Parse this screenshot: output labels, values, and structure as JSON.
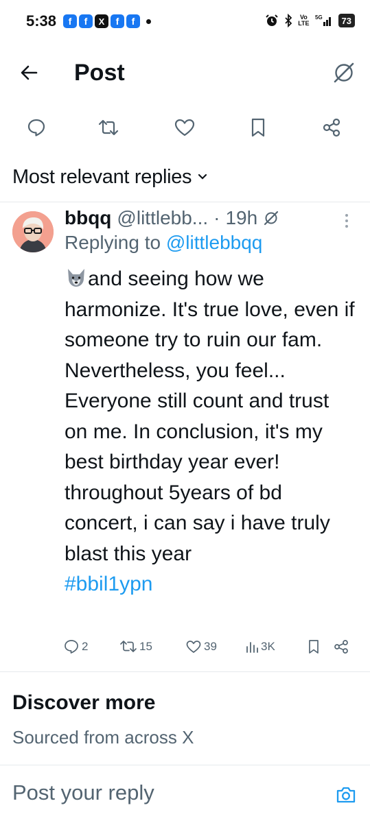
{
  "status_bar": {
    "time": "5:38",
    "app_icons": [
      "f",
      "f",
      "X",
      "f",
      "f"
    ],
    "volte": [
      "Vo",
      "LTE"
    ],
    "network": "5G",
    "battery": "73"
  },
  "header": {
    "title": "Post"
  },
  "sort": {
    "label": "Most relevant replies"
  },
  "reply": {
    "name": "bbqq",
    "handle": "@littlebb...",
    "separator": "·",
    "time": "19h",
    "replying_prefix": "Replying to",
    "replying_handle": "@littlebbqq",
    "text": "and seeing how we harmonize. It's true love, even if someone try to ruin our fam. Nevertheless, you feel... Everyone still count and trust on me. In conclusion, it's my best birthday year ever! throughout 5years of bd concert, i can say i have truly blast this year",
    "hashtag": "#bbil1ypn",
    "stats": {
      "replies": "2",
      "reposts": "15",
      "likes": "39",
      "views": "3K"
    }
  },
  "discover": {
    "title": "Discover more",
    "subtitle": "Sourced from across X"
  },
  "reply_bar": {
    "placeholder": "Post your reply"
  },
  "colors": {
    "accent": "#1d9bf0",
    "text": "#0f1419",
    "secondary": "#536471",
    "divider": "#e6e9ec"
  }
}
